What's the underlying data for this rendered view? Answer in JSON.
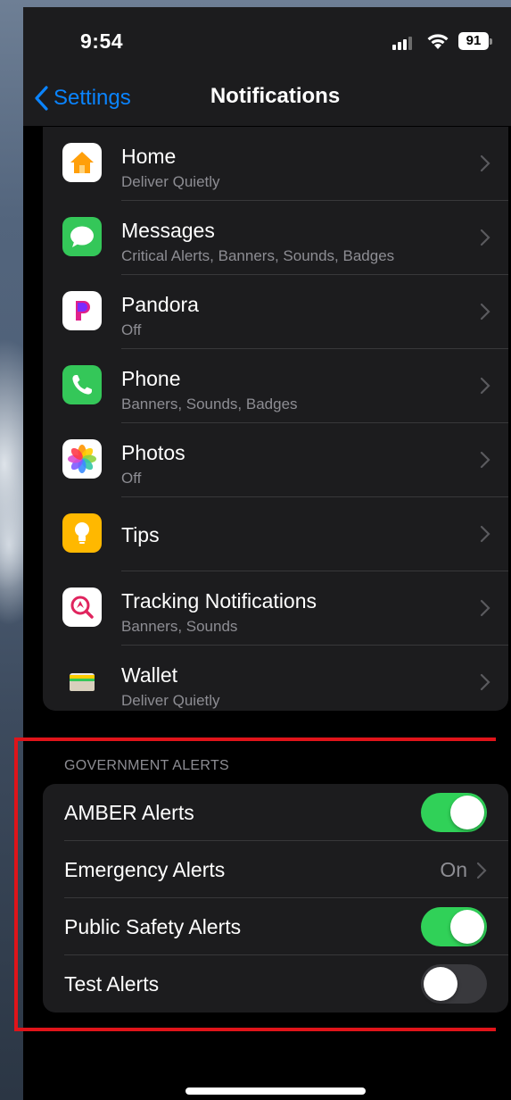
{
  "status": {
    "time": "9:54",
    "battery": "91"
  },
  "nav": {
    "back_label": "Settings",
    "title": "Notifications"
  },
  "apps": [
    {
      "name": "Home",
      "subtitle": "Deliver Quietly",
      "icon": "home-icon"
    },
    {
      "name": "Messages",
      "subtitle": "Critical Alerts, Banners, Sounds, Badges",
      "icon": "messages-icon"
    },
    {
      "name": "Pandora",
      "subtitle": "Off",
      "icon": "pandora-icon"
    },
    {
      "name": "Phone",
      "subtitle": "Banners, Sounds, Badges",
      "icon": "phone-icon"
    },
    {
      "name": "Photos",
      "subtitle": "Off",
      "icon": "photos-icon"
    },
    {
      "name": "Tips",
      "subtitle": "",
      "icon": "tips-icon"
    },
    {
      "name": "Tracking Notifications",
      "subtitle": "Banners, Sounds",
      "icon": "tracking-icon"
    },
    {
      "name": "Wallet",
      "subtitle": "Deliver Quietly",
      "icon": "wallet-icon"
    }
  ],
  "government_alerts": {
    "header": "GOVERNMENT ALERTS",
    "amber": {
      "label": "AMBER Alerts",
      "enabled": true
    },
    "emergency": {
      "label": "Emergency Alerts",
      "value": "On"
    },
    "public_safety": {
      "label": "Public Safety Alerts",
      "enabled": true
    },
    "test": {
      "label": "Test Alerts",
      "enabled": false
    }
  },
  "colors": {
    "accent": "#0a84ff",
    "toggle_on": "#30d158",
    "highlight_box": "#e0141a"
  }
}
